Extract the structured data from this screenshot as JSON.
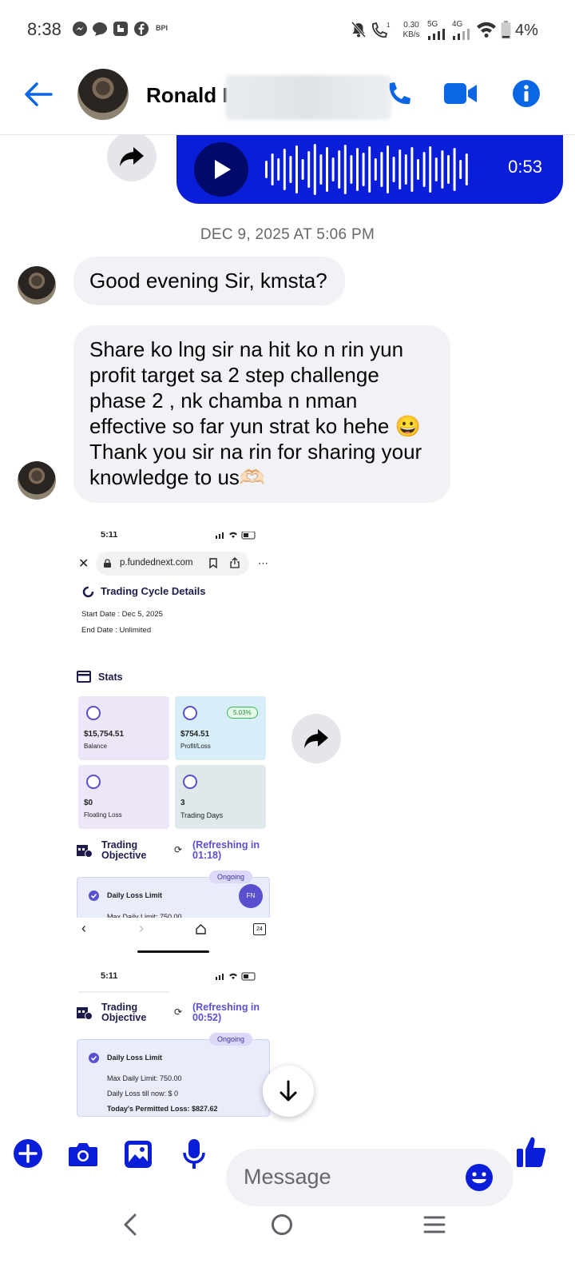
{
  "status_bar": {
    "time": "8:38",
    "carrier_badge": "BPI",
    "net_speed_value": "0.30",
    "net_speed_unit": "KB/s",
    "net_5g": "5G",
    "net_4g": "4G",
    "battery": "4%",
    "icons": [
      "messenger-icon",
      "chat-icon",
      "phone-app-icon",
      "facebook-icon",
      "bpi-icon",
      "mute-icon",
      "wifi-call-icon",
      "signal-icon",
      "wifi-icon",
      "battery-icon"
    ]
  },
  "header": {
    "contact_name": "Ronald I",
    "icons": [
      "back-arrow-icon",
      "phone-icon",
      "video-camera-icon",
      "info-icon"
    ],
    "accent_color": "#0a66e4"
  },
  "messages": {
    "voice_duration": "0:53",
    "timestamp": "DEC 9, 2025 AT 5:06 PM",
    "greeting": "Good evening Sir, kmsta?",
    "long_message": "Share ko lng sir na hit ko n rin yun profit target sa 2 step challenge phase 2 , nk chamba n nman effective so far yun strat ko hehe 😀 Thank you sir na rin for sharing your knowledge to us🫶🏻",
    "voice_bubble_color": "#0a1ed9"
  },
  "screenshot": {
    "time_1": "5:11",
    "url": "p.fundednext.com",
    "section_title": "Trading Cycle Details",
    "start_date": "Start Date : Dec 5, 2025",
    "end_date": "End Date : Unlimited",
    "stats_title": "Stats",
    "balance_value": "$15,754.51",
    "balance_label": "Balance",
    "profit_value": "$754.51",
    "profit_label": "Profit/Loss",
    "profit_pct": "5.03%",
    "floating_value": "$0",
    "floating_label": "Floating Loss",
    "days_value": "3",
    "days_label": "Trading Days",
    "objective_title_1": "Trading",
    "objective_title_2": "Objective",
    "refresh_1a": "(Refreshing in",
    "refresh_1b": "01:18)",
    "ongoing": "Ongoing",
    "daily_loss_limit": "Daily Loss Limit",
    "max_daily_limit": "Max Daily Limit: 750.00",
    "fn_badge": "FN",
    "tabs_count": "24",
    "time_2": "5:11",
    "refresh_2a": "(Refreshing in",
    "refresh_2b": "00:52)",
    "daily_loss_till_now": "Daily Loss till now: $ 0",
    "permitted_loss": "Today's Permitted Loss: $827.62"
  },
  "composer": {
    "placeholder": "Message",
    "icons": [
      "add-icon",
      "camera-icon",
      "gallery-icon",
      "microphone-icon",
      "emoji-icon",
      "like-icon"
    ]
  },
  "nav_bar": {
    "icons": [
      "nav-back-icon",
      "nav-home-icon",
      "nav-recents-icon"
    ]
  }
}
